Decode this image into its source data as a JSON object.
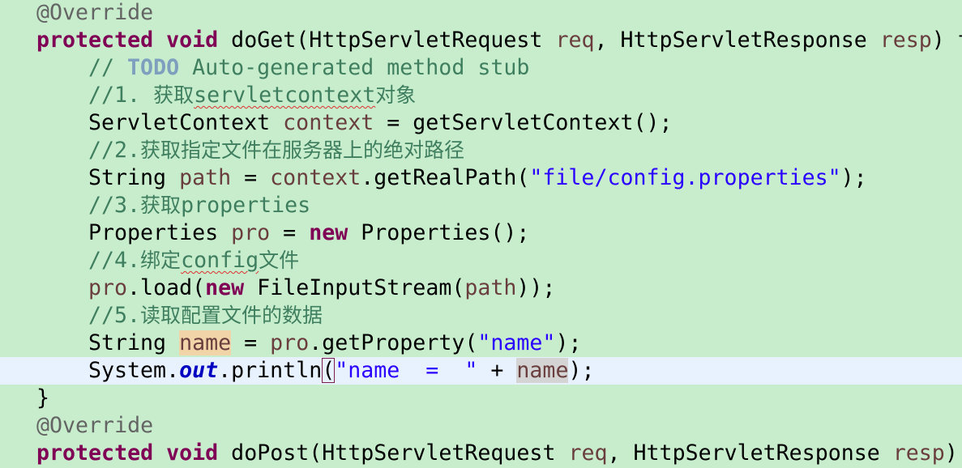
{
  "editor": {
    "colors": {
      "background": "#c7edcc",
      "current_line": "#e8f2fe",
      "keyword": "#7f0055",
      "string": "#2a00ff",
      "comment": "#3f7f5f"
    },
    "current_line_index": 13,
    "lines": [
      {
        "indent": 1,
        "tokens": [
          {
            "t": "@Override",
            "c": "ann"
          }
        ]
      },
      {
        "indent": 1,
        "tokens": [
          {
            "t": "protected",
            "c": "kw"
          },
          {
            "t": " "
          },
          {
            "t": "void",
            "c": "kw"
          },
          {
            "t": " doGet(HttpServletRequest "
          },
          {
            "t": "req",
            "c": "var"
          },
          {
            "t": ", HttpServletResponse "
          },
          {
            "t": "resp",
            "c": "var"
          },
          {
            "t": ") t"
          }
        ]
      },
      {
        "indent": 2,
        "tokens": [
          {
            "t": "// ",
            "c": "cm"
          },
          {
            "t": "TODO",
            "c": "todo"
          },
          {
            "t": " Auto-generated method stub",
            "c": "cm"
          }
        ]
      },
      {
        "indent": 2,
        "tokens": [
          {
            "t": "//1. ",
            "c": "cm"
          },
          {
            "t": "获取",
            "c": "cm cn"
          },
          {
            "t": "servletcontext",
            "c": "cm sq"
          },
          {
            "t": "对象",
            "c": "cm cn"
          }
        ]
      },
      {
        "indent": 2,
        "tokens": [
          {
            "t": "ServletContext "
          },
          {
            "t": "context",
            "c": "var"
          },
          {
            "t": " = getServletContext();"
          }
        ]
      },
      {
        "indent": 2,
        "tokens": [
          {
            "t": "//2.",
            "c": "cm"
          },
          {
            "t": "获取指定文件在服务器上的绝对路径",
            "c": "cm cn"
          }
        ]
      },
      {
        "indent": 2,
        "tokens": [
          {
            "t": "String "
          },
          {
            "t": "path",
            "c": "var"
          },
          {
            "t": " = "
          },
          {
            "t": "context",
            "c": "var"
          },
          {
            "t": ".getRealPath("
          },
          {
            "t": "\"file/config.properties\"",
            "c": "str"
          },
          {
            "t": ");"
          }
        ]
      },
      {
        "indent": 2,
        "tokens": [
          {
            "t": "//3.",
            "c": "cm"
          },
          {
            "t": "获取",
            "c": "cm cn"
          },
          {
            "t": "properties",
            "c": "cm"
          }
        ]
      },
      {
        "indent": 2,
        "tokens": [
          {
            "t": "Properties "
          },
          {
            "t": "pro",
            "c": "var"
          },
          {
            "t": " = "
          },
          {
            "t": "new",
            "c": "kw"
          },
          {
            "t": " Properties();"
          }
        ]
      },
      {
        "indent": 2,
        "tokens": [
          {
            "t": "//4.",
            "c": "cm"
          },
          {
            "t": "绑定",
            "c": "cm cn"
          },
          {
            "t": "config",
            "c": "cm sq"
          },
          {
            "t": "文件",
            "c": "cm cn"
          }
        ]
      },
      {
        "indent": 2,
        "tokens": [
          {
            "t": "pro",
            "c": "var"
          },
          {
            "t": ".load("
          },
          {
            "t": "new",
            "c": "kw"
          },
          {
            "t": " FileInputStream("
          },
          {
            "t": "path",
            "c": "var"
          },
          {
            "t": "));"
          }
        ]
      },
      {
        "indent": 2,
        "tokens": [
          {
            "t": "//5.",
            "c": "cm"
          },
          {
            "t": "读取配置文件的数据",
            "c": "cm cn"
          }
        ]
      },
      {
        "indent": 2,
        "tokens": [
          {
            "t": "String "
          },
          {
            "t": "name",
            "c": "var occ"
          },
          {
            "t": " = "
          },
          {
            "t": "pro",
            "c": "var"
          },
          {
            "t": ".getProperty("
          },
          {
            "t": "\"name\"",
            "c": "str"
          },
          {
            "t": ");"
          }
        ]
      },
      {
        "indent": 2,
        "tokens": [
          {
            "t": "System."
          },
          {
            "t": "out",
            "c": "fld"
          },
          {
            "t": ".println"
          },
          {
            "t": "(",
            "c": "brk"
          },
          {
            "t": "\"name  =  \"",
            "c": "str"
          },
          {
            "t": " + "
          },
          {
            "t": "name",
            "c": "var occ2"
          },
          {
            "t": ");"
          }
        ]
      },
      {
        "indent": 1,
        "tokens": [
          {
            "t": "}"
          }
        ]
      },
      {
        "indent": 1,
        "tokens": [
          {
            "t": "@Override",
            "c": "ann"
          }
        ]
      },
      {
        "indent": 1,
        "tokens": [
          {
            "t": "protected",
            "c": "kw"
          },
          {
            "t": " "
          },
          {
            "t": "void",
            "c": "kw"
          },
          {
            "t": " doPost(HttpServletRequest "
          },
          {
            "t": "req",
            "c": "var"
          },
          {
            "t": ", HttpServletResponse "
          },
          {
            "t": "resp",
            "c": "var"
          },
          {
            "t": ")"
          }
        ]
      }
    ]
  }
}
